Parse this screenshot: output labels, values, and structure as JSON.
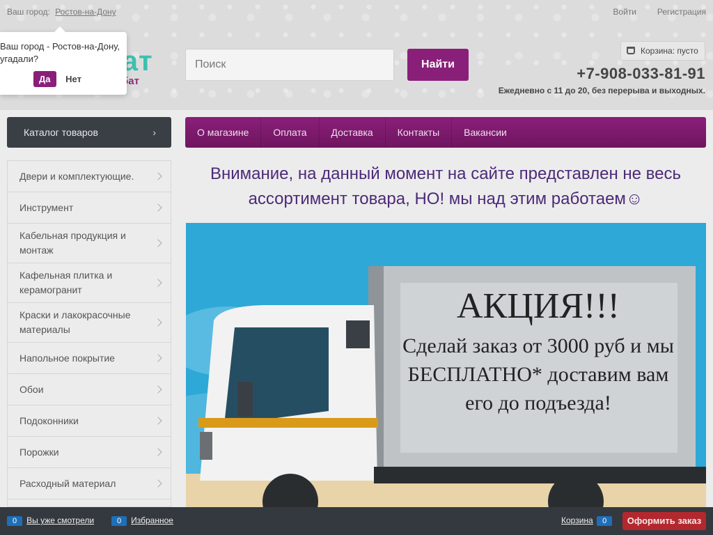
{
  "top": {
    "city_prefix": "Ваш город:",
    "city": "Ростов-на-Дону",
    "login": "Войти",
    "register": "Регистрация"
  },
  "popup": {
    "question": "Ваш город - Ростов-на-Дону, угадали?",
    "yes": "Да",
    "no": "Нет"
  },
  "logo": {
    "main": "бат",
    "sub": "-Арбат"
  },
  "search": {
    "placeholder": "Поиск",
    "button": "Найти"
  },
  "cart_chip": {
    "label": "Корзина: пусто",
    "icon": "basket-icon"
  },
  "contacts": {
    "phone": "+7-908-033-81-91",
    "hours": "Ежедневно с 11 до 20, без перерыва и выходных."
  },
  "catalog_button": "Каталог товаров",
  "nav": [
    "О магазине",
    "Оплата",
    "Доставка",
    "Контакты",
    "Вакансии"
  ],
  "sidebar": [
    "Двери и комплектующие.",
    "Инструмент",
    "Кабельная продукция и монтаж",
    "Кафельная плитка и керамогранит",
    "Краски и лакокрасочные материалы",
    "Напольное покрытие",
    "Обои",
    "Подоконники",
    "Порожки",
    "Расходный материал"
  ],
  "notice": "Внимание, на данный момент на сайте представлен не весь ассортимент товара, НО! мы над этим работаем☺",
  "banner": {
    "title": "АКЦИЯ!!!",
    "body": "Сделай заказ от 3000 руб и мы БЕСПЛАТНО* доставим вам его до подъезда!"
  },
  "bottom_bar": {
    "viewed_count": "0",
    "viewed_label": "Вы уже смотрели",
    "fav_count": "0",
    "fav_label": "Избранное",
    "cart_label": "Корзина",
    "cart_count": "0",
    "order_button": "Оформить заказ"
  },
  "colors": {
    "accent": "#8a1f7a",
    "logo_teal": "#3cc0b0",
    "dark_bar": "#34393f",
    "order_red": "#b3282e",
    "badge_blue": "#1e6fb8"
  }
}
